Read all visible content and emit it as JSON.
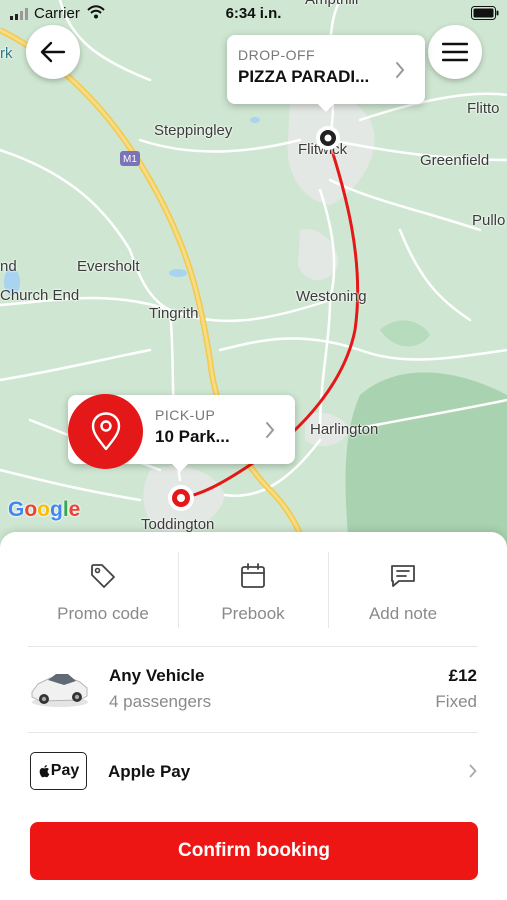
{
  "status_bar": {
    "carrier": "Carrier",
    "time": "6:34 i.n."
  },
  "map": {
    "places": [
      "Flitwick",
      "Steppingley",
      "Greenfield",
      "Eversholt",
      "Church End",
      "Tingrith",
      "Westoning",
      "Harlington",
      "Toddington",
      "Flitto",
      "Pullo",
      "nd",
      "rk",
      "Ampthill"
    ],
    "road_badge": "M1",
    "attribution": "Google",
    "route_color": "#e41818"
  },
  "dropoff": {
    "label": "DROP-OFF",
    "value": "PIZZA PARADI..."
  },
  "pickup": {
    "label": "PICK-UP",
    "value": "10 Park..."
  },
  "actions": [
    {
      "label": "Promo code",
      "icon": "tag-icon"
    },
    {
      "label": "Prebook",
      "icon": "calendar-icon"
    },
    {
      "label": "Add note",
      "icon": "note-icon"
    }
  ],
  "vehicle": {
    "title": "Any Vehicle",
    "passengers": "4 passengers",
    "price": "£12",
    "price_type": "Fixed"
  },
  "payment": {
    "logo_text": "Pay",
    "method": "Apple Pay"
  },
  "confirm": {
    "label": "Confirm booking"
  },
  "colors": {
    "accent": "#ee1515"
  }
}
